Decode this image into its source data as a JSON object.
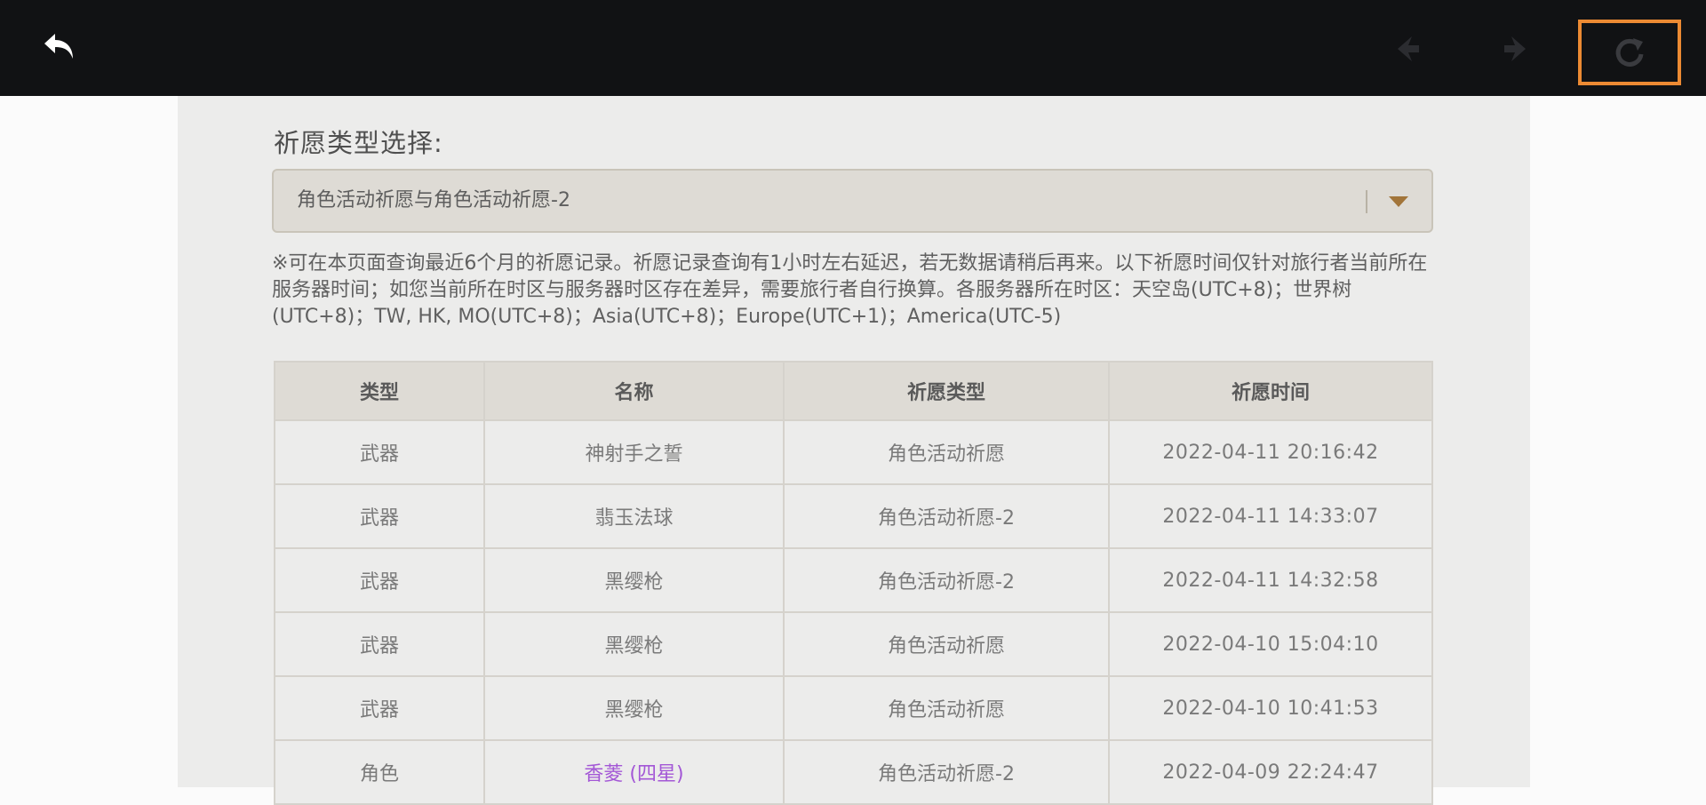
{
  "toolbar": {
    "back_icon": "back-arrow-icon",
    "prev_icon": "prev-arrow-icon",
    "next_icon": "next-arrow-icon",
    "refresh_icon": "refresh-icon",
    "highlight_color": "#ec8a33"
  },
  "filter": {
    "label": "祈愿类型选择:",
    "selected": "角色活动祈愿与角色活动祈愿-2"
  },
  "notice": "※可在本页面查询最近6个月的祈愿记录。祈愿记录查询有1小时左右延迟，若无数据请稍后再来。以下祈愿时间仅针对旅行者当前所在服务器时间；如您当前所在时区与服务器时区存在差异，需要旅行者自行换算。各服务器所在时区：天空岛(UTC+8)；世界树(UTC+8)；TW, HK, MO(UTC+8)；Asia(UTC+8)；Europe(UTC+1)；America(UTC-5)",
  "table": {
    "headers": [
      "类型",
      "名称",
      "祈愿类型",
      "祈愿时间"
    ],
    "rows": [
      {
        "type": "武器",
        "name": "神射手之誓",
        "wish": "角色活动祈愿",
        "time": "2022-04-11 20:16:42",
        "rarity": 3
      },
      {
        "type": "武器",
        "name": "翡玉法球",
        "wish": "角色活动祈愿-2",
        "time": "2022-04-11 14:33:07",
        "rarity": 3
      },
      {
        "type": "武器",
        "name": "黑缨枪",
        "wish": "角色活动祈愿-2",
        "time": "2022-04-11 14:32:58",
        "rarity": 3
      },
      {
        "type": "武器",
        "name": "黑缨枪",
        "wish": "角色活动祈愿",
        "time": "2022-04-10 15:04:10",
        "rarity": 3
      },
      {
        "type": "武器",
        "name": "黑缨枪",
        "wish": "角色活动祈愿",
        "time": "2022-04-10 10:41:53",
        "rarity": 3
      },
      {
        "type": "角色",
        "name": "香菱 (四星)",
        "wish": "角色活动祈愿-2",
        "time": "2022-04-09 22:24:47",
        "rarity": 4
      }
    ],
    "rarity_4_color": "#a357d6"
  }
}
